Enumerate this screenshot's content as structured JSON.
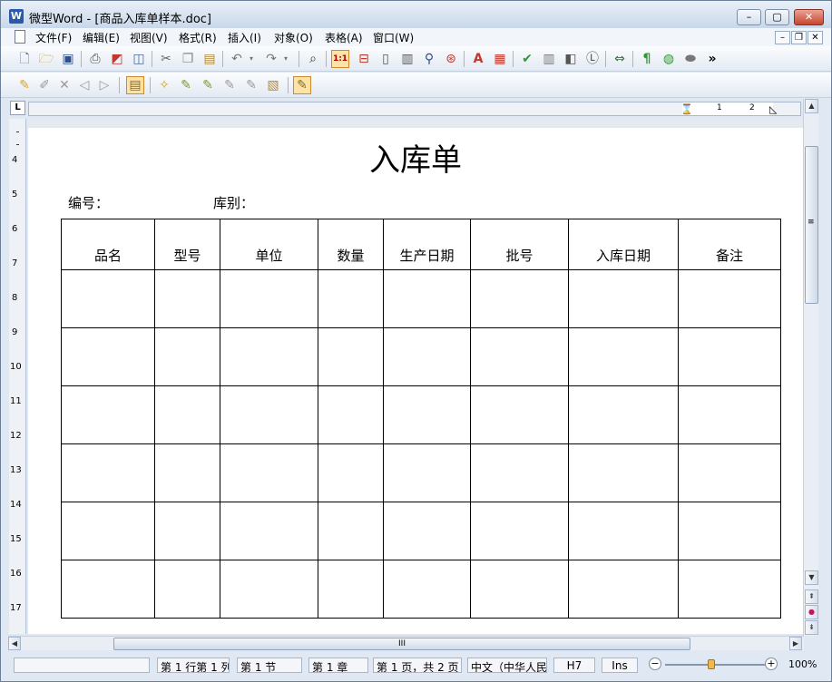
{
  "window": {
    "title": "微型Word - [商品入库单样本.doc]",
    "app_icon_letter": "W",
    "minimize": "–",
    "maximize": "▢",
    "close": "✕"
  },
  "menu": {
    "items": [
      "文件(F)",
      "编辑(E)",
      "视图(V)",
      "格式(R)",
      "插入(I)",
      "对象(O)",
      "表格(A)",
      "窗口(W)"
    ],
    "mdi": {
      "minimize": "–",
      "restore": "❐",
      "close": "✕"
    }
  },
  "toolbar1": {
    "icons": [
      "new-document-icon",
      "open-folder-icon",
      "save-icon",
      "print-icon",
      "pdf-export-icon",
      "print-preview-icon",
      "cut-icon",
      "copy-icon",
      "paste-icon",
      "undo-icon",
      "redo-icon",
      "find-icon",
      "actual-size-icon",
      "page-width-icon",
      "one-page-icon",
      "two-pages-icon",
      "zoom-icon",
      "zoom-settings-icon",
      "font-color-icon",
      "paragraph-icon",
      "spell-check-icon",
      "word-count-icon",
      "shading-icon",
      "line-icon",
      "track-icon",
      "show-marks-icon",
      "hyphen-icon",
      "eraser-icon"
    ],
    "overflow": "»"
  },
  "toolbar2": {
    "icons": [
      "new-comment-icon",
      "edit-comment-icon",
      "delete-comment-icon",
      "previous-comment-icon",
      "next-comment-icon",
      "review-icon",
      "accept-change-icon",
      "reject-change-icon",
      "accept-all-icon",
      "reject-all-icon",
      "compare-icon",
      "track-changes-icon"
    ]
  },
  "ruler": {
    "tab_selector": "L",
    "h_numbers": [
      "1",
      "2"
    ],
    "v_numbers": [
      "4",
      "5",
      "6",
      "7",
      "8",
      "9",
      "10",
      "11",
      "12",
      "13",
      "14",
      "15",
      "16",
      "17"
    ]
  },
  "document": {
    "title": "入库单",
    "field_number": "编号：",
    "field_category": "库别：",
    "table": {
      "headers": [
        "品名",
        "型号",
        "单位",
        "数量",
        "生产日期",
        "批号",
        "入库日期",
        "备注"
      ],
      "empty_rows": 6
    }
  },
  "scrollbar": {
    "up": "▲",
    "down": "▼",
    "prev_page": "⇞",
    "browse": "●",
    "next_page": "⇟",
    "grip": "≡",
    "hgrip": "III",
    "left": "◀",
    "right": "▶"
  },
  "status": {
    "position": "第 1 行第 1 列",
    "section": "第 1 节",
    "chapter": "第 1 章",
    "pages": "第 1 页，共 2 页",
    "language": "中文（中华人民",
    "style": "H7",
    "mode": "Ins",
    "zoom_minus": "−",
    "zoom_plus": "+",
    "zoom": "100%"
  },
  "colors": {
    "accent": "#2b5aa8",
    "close_button": "#c7462f"
  }
}
